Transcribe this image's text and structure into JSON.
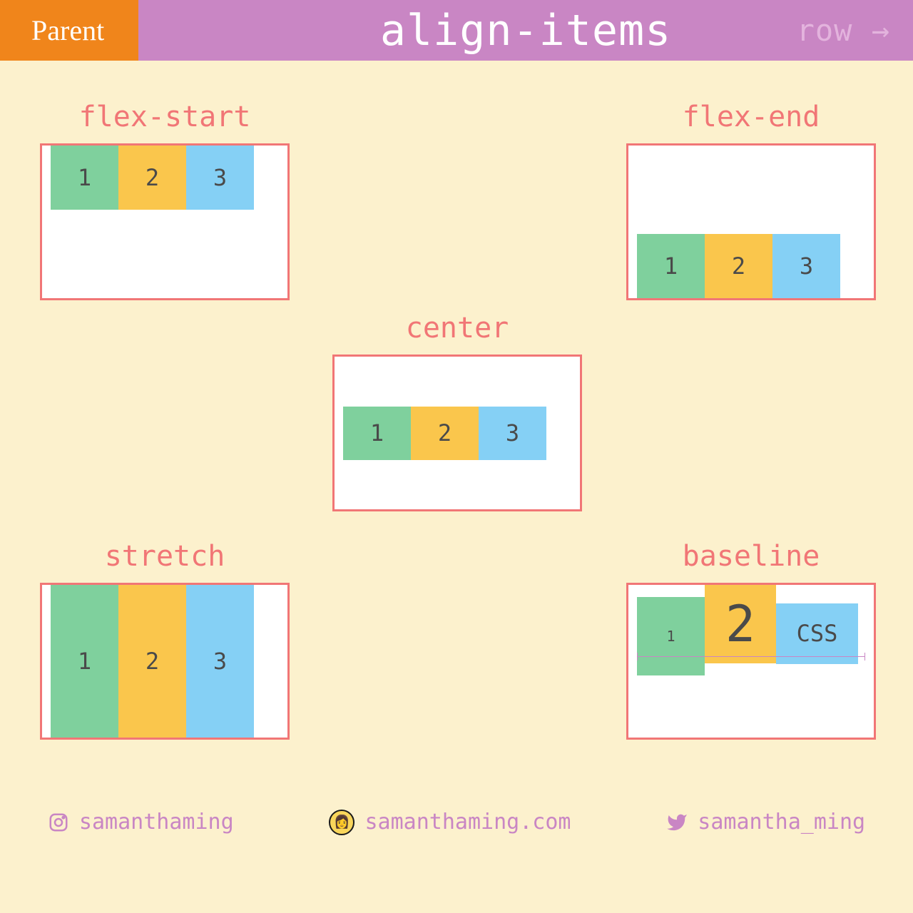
{
  "header": {
    "badge": "Parent",
    "title": "align-items",
    "direction": "row →"
  },
  "sections": {
    "start": {
      "label": "flex-start",
      "items": [
        "1",
        "2",
        "3"
      ]
    },
    "end": {
      "label": "flex-end",
      "items": [
        "1",
        "2",
        "3"
      ]
    },
    "center": {
      "label": "center",
      "items": [
        "1",
        "2",
        "3"
      ]
    },
    "stretch": {
      "label": "stretch",
      "items": [
        "1",
        "2",
        "3"
      ]
    },
    "baseline": {
      "label": "baseline",
      "items": [
        "1",
        "2",
        "CSS"
      ]
    }
  },
  "footer": {
    "instagram": "samanthaming",
    "website": "samanthaming.com",
    "twitter": "samantha_ming"
  }
}
